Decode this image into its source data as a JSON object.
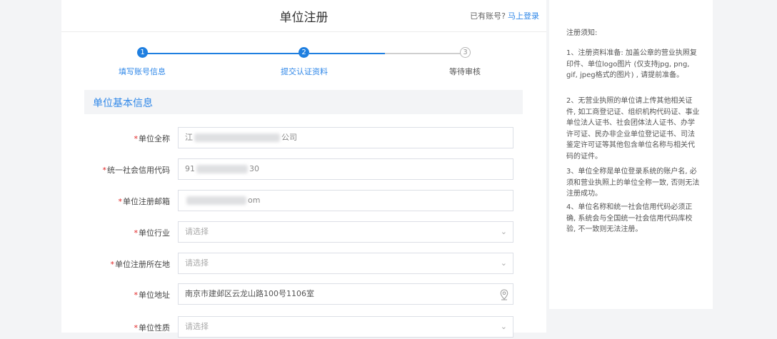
{
  "header": {
    "title": "单位注册",
    "login_prompt": "已有账号?",
    "login_link": "马上登录"
  },
  "steps": [
    {
      "number": "1",
      "label": "填写账号信息",
      "status": "active"
    },
    {
      "number": "2",
      "label": "提交认证资料",
      "status": "active"
    },
    {
      "number": "3",
      "label": "等待审核",
      "status": "pending"
    }
  ],
  "section": {
    "title": "单位基本信息"
  },
  "form": {
    "required_mark": "*",
    "fields": [
      {
        "label": "单位全称",
        "type": "text",
        "value_start": "江",
        "value_end": "公司"
      },
      {
        "label": "统一社会信用代码",
        "type": "text",
        "value_start": "91",
        "value_end": "30"
      },
      {
        "label": "单位注册邮箱",
        "type": "text",
        "value_start": "",
        "value_end": "om"
      },
      {
        "label": "单位行业",
        "type": "select",
        "placeholder": "请选择"
      },
      {
        "label": "单位注册所在地",
        "type": "select",
        "placeholder": "请选择"
      },
      {
        "label": "单位地址",
        "type": "text",
        "value": "南京市建邺区云龙山路100号1106室",
        "icon": "location-pin-icon"
      },
      {
        "label": "单位性质",
        "type": "select",
        "placeholder": "请选择"
      }
    ]
  },
  "notice": {
    "title": "注册须知:",
    "items": [
      "1、注册资料准备: 加盖公章的营业执照复印件、单位logo图片 (仅支持jpg, png, gif, jpeg格式的图片) , 请提前准备。",
      "2、无营业执照的单位请上传其他相关证件, 如工商登记证、组织机构代码证、事业单位法人证书、社会团体法人证书、办学许可证、民办非企业单位登记证书、司法鉴定许可证等其他包含单位名称与相关代码的证件。",
      "3、单位全称是单位登录系统的账户名, 必须和营业执照上的单位全称一致, 否则无法注册成功。",
      "4、单位名称和统一社会信用代码必须正确, 系统会与全国统一社会信用代码库校验, 不一致则无法注册。"
    ]
  },
  "colors": {
    "accent": "#1f7fe0",
    "required": "#e02424",
    "background": "#f3f4f6"
  }
}
